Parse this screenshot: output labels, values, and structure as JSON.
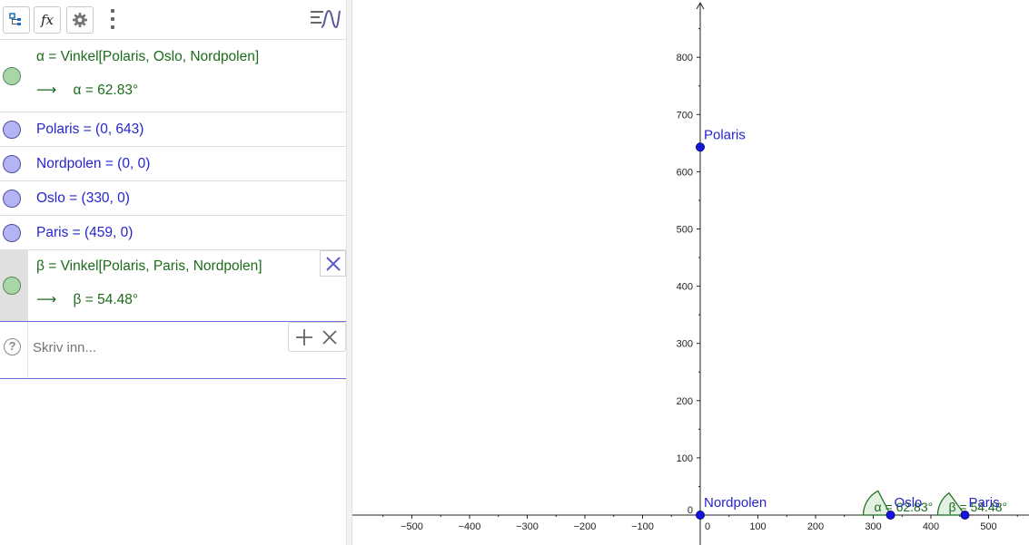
{
  "toolbar": {
    "fx_label": "𝑓x",
    "buttons": [
      "algebra-description-icon",
      "fx-icon",
      "gear-icon",
      "more-vert-icon",
      "style-bar-toggle-icon"
    ]
  },
  "algebra": {
    "rows": [
      {
        "id": "alpha",
        "type": "angle",
        "definition": "α = Vinkel[Polaris, Oslo, Nordpolen]",
        "value": "α = 62.83°",
        "arrow": "⟶"
      },
      {
        "id": "polaris",
        "type": "point",
        "text": "Polaris = (0, 643)"
      },
      {
        "id": "nordpolen",
        "type": "point",
        "text": "Nordpolen = (0, 0)"
      },
      {
        "id": "oslo",
        "type": "point",
        "text": "Oslo = (330, 0)"
      },
      {
        "id": "paris",
        "type": "point",
        "text": "Paris = (459, 0)"
      },
      {
        "id": "beta",
        "type": "angle",
        "definition": "β = Vinkel[Polaris, Paris, Nordpolen]",
        "value": "β = 54.48°",
        "arrow": "⟶",
        "selected": true
      }
    ],
    "input_placeholder": "Skriv inn..."
  },
  "graphics": {
    "x_ticks": [
      "−500",
      "−400",
      "−300",
      "−200",
      "−100",
      "0",
      "100",
      "200",
      "300",
      "400",
      "500"
    ],
    "y_ticks": [
      "100",
      "200",
      "300",
      "400",
      "500",
      "600",
      "700",
      "800"
    ],
    "origin_label": "0",
    "points": [
      {
        "name": "Polaris",
        "x": 0,
        "y": 643
      },
      {
        "name": "Nordpolen",
        "x": 0,
        "y": 0
      },
      {
        "name": "Oslo",
        "x": 330,
        "y": 0
      },
      {
        "name": "Paris",
        "x": 459,
        "y": 0
      }
    ],
    "angle_labels": {
      "alpha": "α = 62.83°",
      "beta": "β = 54.48°"
    },
    "colors": {
      "point": "#1515e0",
      "point_label": "#2525d0",
      "angle": "#1b6b1b",
      "angle_fill": "#d8ecd8"
    }
  }
}
